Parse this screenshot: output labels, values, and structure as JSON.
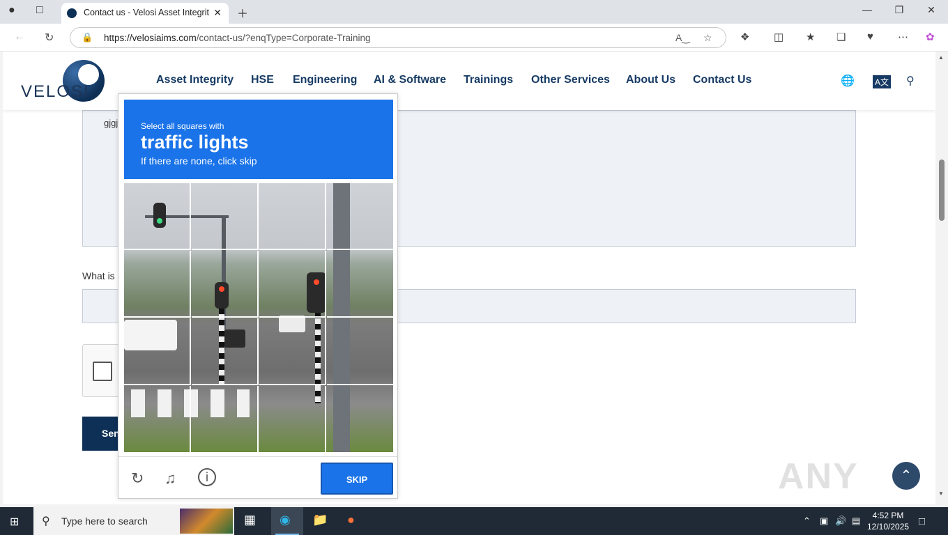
{
  "browser": {
    "tab_title": "Contact us - Velosi Asset Integrity",
    "url_host": "https://velosiaims.com",
    "url_path": "/contact-us/?enqType=Corporate-Training"
  },
  "site": {
    "logo_text": "VELOSI",
    "nav": [
      "Asset Integrity",
      "HSE",
      "Engineering",
      "AI & Software",
      "Trainings",
      "Other Services",
      "About Us",
      "Contact Us"
    ]
  },
  "form": {
    "message_value": "gjgj",
    "question_label": "What is",
    "send_label": "Sen"
  },
  "captcha": {
    "line1": "Select all squares with",
    "target": "traffic lights",
    "line3": "If there are none, click skip",
    "skip_label": "SKIP"
  },
  "watermark": "ANY RUN",
  "taskbar": {
    "search_placeholder": "Type here to search",
    "time": "4:52 PM",
    "date": "12/10/2025"
  },
  "icons": [
    "back-icon",
    "reload-icon",
    "lock-icon",
    "read-aloud-icon",
    "favorite-icon",
    "extensions-icon",
    "split-icon",
    "favorites-icon",
    "collections-icon",
    "performance-icon",
    "more-icon",
    "copilot-icon",
    "globe-icon",
    "translate-icon",
    "search-icon",
    "refresh-icon",
    "audio-icon",
    "info-icon"
  ]
}
